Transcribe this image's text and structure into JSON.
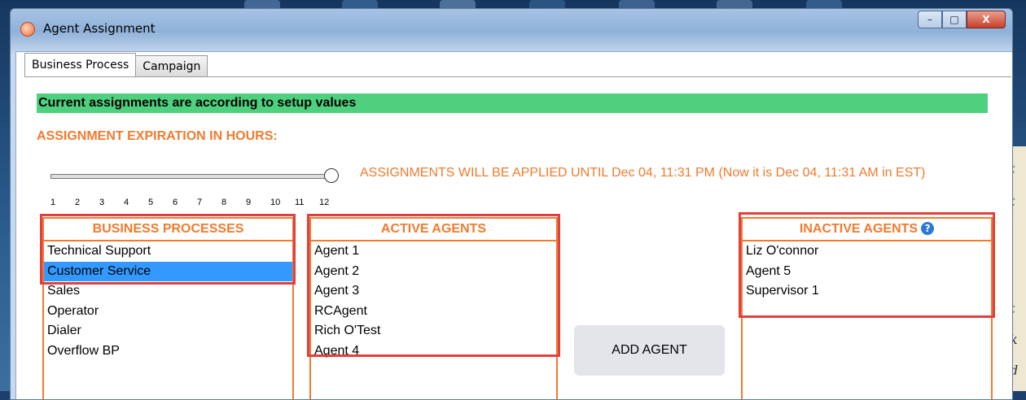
{
  "window": {
    "title": "Agent Assignment",
    "controls": {
      "minimize": "–",
      "maximize": "□",
      "close": "X"
    }
  },
  "tabs": [
    {
      "label": "Business Process",
      "active": true
    },
    {
      "label": "Campaign",
      "active": false
    }
  ],
  "status": {
    "text": "Current assignments are according to setup values",
    "color": "#4fd07e"
  },
  "expiration": {
    "label": "ASSIGNMENT EXPIRATION IN HOURS:",
    "value_hours": 12,
    "ticks": [
      "1",
      "2",
      "3",
      "4",
      "5",
      "6",
      "7",
      "8",
      "9",
      "10",
      "11",
      "12"
    ],
    "apply_text": "ASSIGNMENTS WILL BE APPLIED UNTIL Dec 04, 11:31 PM (Now it is Dec 04, 11:31 AM in EST)"
  },
  "business_processes": {
    "header": "BUSINESS PROCESSES",
    "items": [
      "Technical Support",
      "Customer Service",
      "Sales",
      "Operator",
      "Dialer",
      "Overflow BP"
    ],
    "selected": "Customer Service"
  },
  "active_agents": {
    "header": "ACTIVE AGENTS",
    "items": [
      "Agent 1",
      "Agent 2",
      "Agent 3",
      "RCAgent",
      "Rich O'Test",
      "Agent 4"
    ]
  },
  "add_agent": {
    "label": "ADD AGENT"
  },
  "inactive_agents": {
    "header": "INACTIVE AGENTS",
    "help_icon": "?",
    "items": [
      "Liz O'connor",
      "Agent 5",
      "Supervisor 1"
    ]
  },
  "colors": {
    "accent": "#f07b2f",
    "highlight": "#e0403f",
    "selection": "#3399ff"
  },
  "background_text": [
    "t",
    "t",
    "t",
    "k",
    "d"
  ]
}
